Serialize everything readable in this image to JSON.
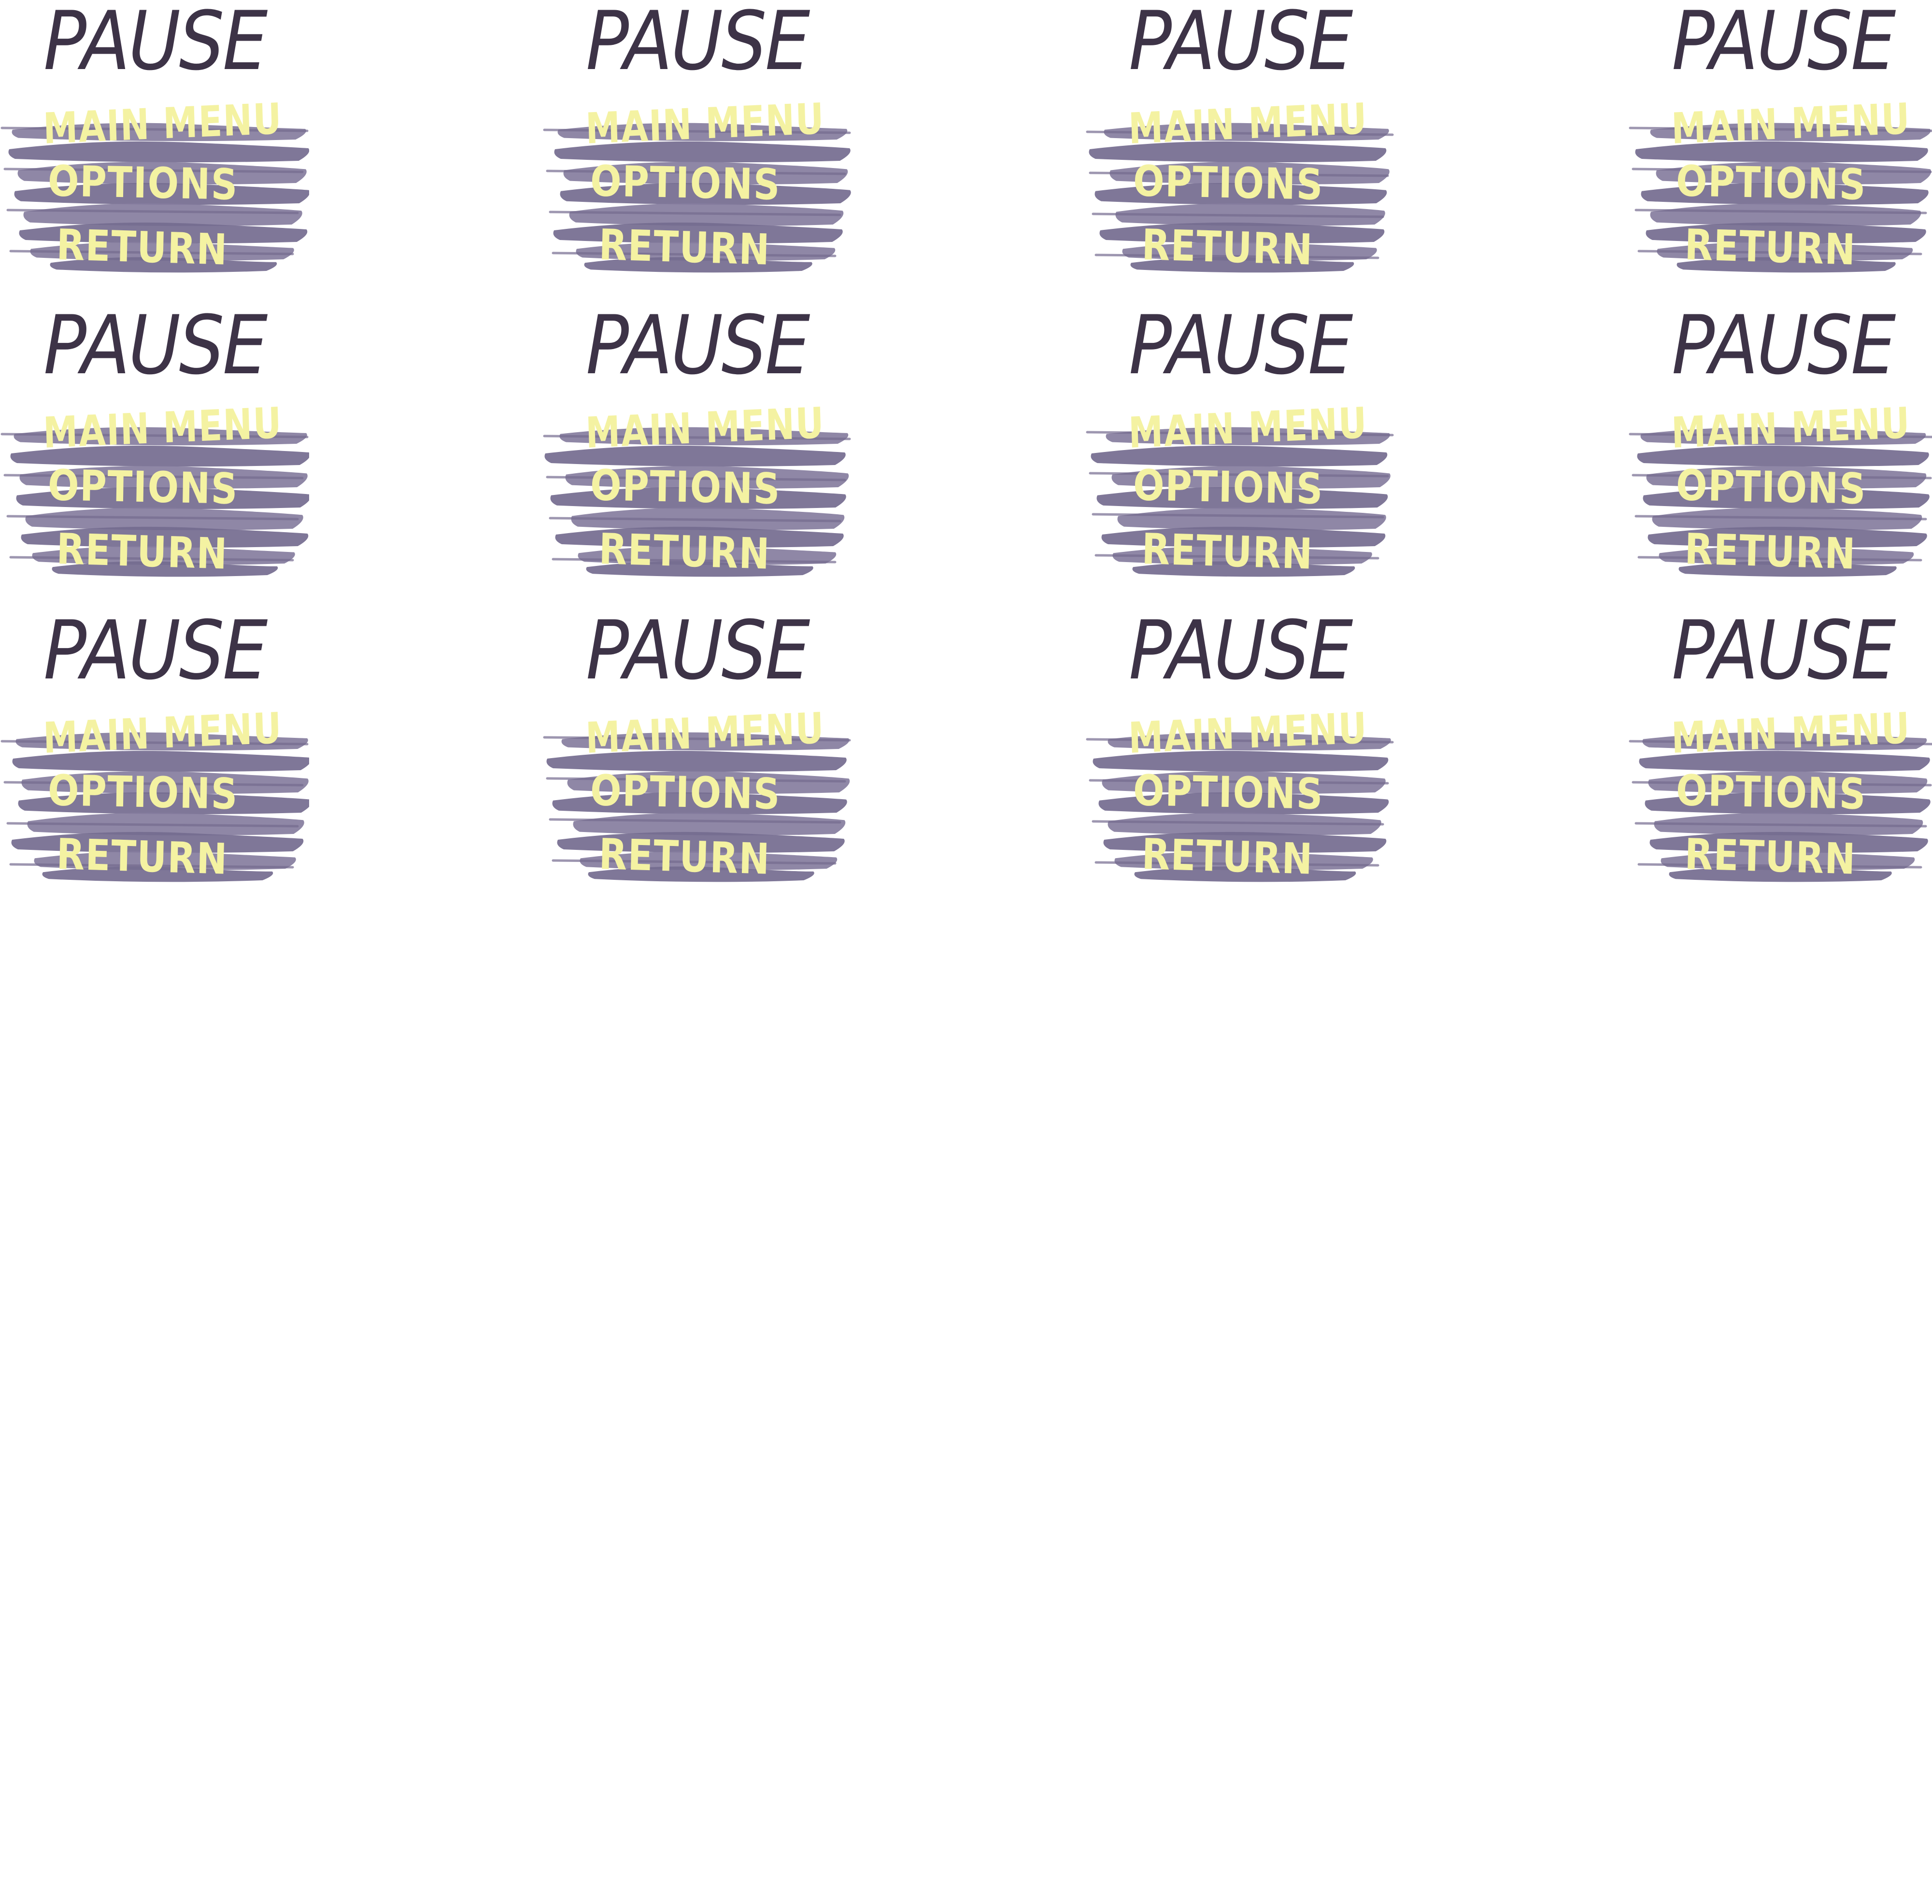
{
  "sheet": {
    "frames": [
      {
        "title": "PAUSE",
        "menu": [
          "MAIN MENU",
          "OPTIONS",
          "RETURN"
        ]
      },
      {
        "title": "PAUSE",
        "menu": [
          "MAIN MENU",
          "OPTIONS",
          "RETURN"
        ]
      },
      {
        "title": "PAUSE",
        "menu": [
          "MAIN MENU",
          "OPTIONS",
          "RETURN"
        ]
      },
      {
        "title": "PAUSE",
        "menu": [
          "MAIN MENU",
          "OPTIONS",
          "RETURN"
        ]
      },
      {
        "title": "PAUSE",
        "menu": [
          "MAIN MENU",
          "OPTIONS",
          "RETURN"
        ]
      },
      {
        "title": "PAUSE",
        "menu": [
          "MAIN MENU",
          "OPTIONS",
          "RETURN"
        ]
      },
      {
        "title": "PAUSE",
        "menu": [
          "MAIN MENU",
          "OPTIONS",
          "RETURN"
        ]
      },
      {
        "title": "PAUSE",
        "menu": [
          "MAIN MENU",
          "OPTIONS",
          "RETURN"
        ]
      },
      {
        "title": "PAUSE",
        "menu": [
          "MAIN MENU",
          "OPTIONS",
          "RETURN"
        ]
      },
      {
        "title": "PAUSE",
        "menu": [
          "MAIN MENU",
          "OPTIONS",
          "RETURN"
        ]
      },
      {
        "title": "PAUSE",
        "menu": [
          "MAIN MENU",
          "OPTIONS",
          "RETURN"
        ]
      },
      {
        "title": "PAUSE",
        "menu": [
          "MAIN MENU",
          "OPTIONS",
          "RETURN"
        ]
      }
    ]
  },
  "colors": {
    "title": "#3d3347",
    "brush": "#857d9e",
    "brush_dark": "#746b8f",
    "menu_text": "#f4f2a2",
    "background": "#ffffff"
  }
}
